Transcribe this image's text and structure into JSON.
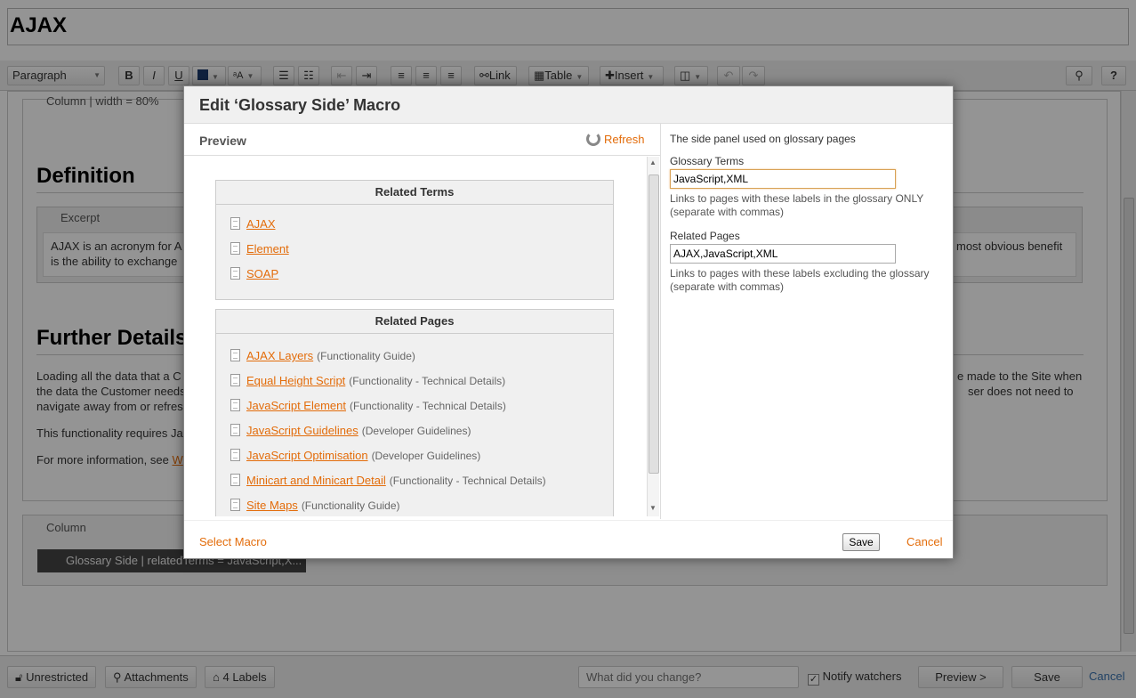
{
  "page": {
    "title": "AJAX"
  },
  "toolbar": {
    "paragraph": "Paragraph",
    "bold": "B",
    "italic": "I",
    "underline": "U",
    "link": "Link",
    "table": "Table",
    "insert": "Insert",
    "help": "?"
  },
  "editor": {
    "column1_label": "Column | width = 80%",
    "definition_heading": "Definition",
    "excerpt_label": "Excerpt",
    "excerpt_text_left": "AJAX is an acronym for A",
    "excerpt_text_left2": "is the ability to exchange",
    "excerpt_text_right": "most obvious benefit",
    "further_heading": "Further Details",
    "para1_left": "Loading all the data that a C",
    "para1_left2": "the data the Customer needs",
    "para1_left3": "navigate away from or refresh",
    "para1_right": "e made to the Site when",
    "para1_right2": "ser does not need to",
    "para2_left": "This functionality requires Jav",
    "para3_left": "For more information, see",
    "para3_link": "W",
    "column2_label": "Column",
    "glossary_macro": "Glossary Side | relatedTerms = JavaScript,X..."
  },
  "bottom": {
    "restrictions": "Unrestricted",
    "attachments": "Attachments",
    "labels": "4 Labels",
    "comment_placeholder": "What did you change?",
    "notify": "Notify watchers",
    "preview": "Preview >",
    "save": "Save",
    "cancel": "Cancel"
  },
  "dialog": {
    "title": "Edit ‘Glossary Side’ Macro",
    "preview_label": "Preview",
    "refresh": "Refresh",
    "related_terms_header": "Related Terms",
    "related_terms": [
      {
        "title": "AJAX"
      },
      {
        "title": "Element"
      },
      {
        "title": "SOAP"
      }
    ],
    "related_pages_header": "Related Pages",
    "related_pages": [
      {
        "title": "AJAX Layers",
        "category": "(Functionality Guide)"
      },
      {
        "title": "Equal Height Script",
        "category": "(Functionality - Technical Details)"
      },
      {
        "title": "JavaScript Element",
        "category": "(Functionality - Technical Details)"
      },
      {
        "title": "JavaScript Guidelines",
        "category": "(Developer Guidelines)"
      },
      {
        "title": "JavaScript Optimisation",
        "category": "(Developer Guidelines)"
      },
      {
        "title": "Minicart and Minicart Detail",
        "category": "(Functionality - Technical Details)"
      },
      {
        "title": "Site Maps",
        "category": "(Functionality Guide)"
      }
    ],
    "macro_description": "The side panel used on glossary pages",
    "glossary_terms_label": "Glossary Terms",
    "glossary_terms_value": "JavaScript,XML",
    "glossary_terms_help": "Links to pages with these labels in the glossary ONLY (separate with commas)",
    "related_pages_label": "Related Pages",
    "related_pages_value": "AJAX,JavaScript,XML",
    "related_pages_help": "Links to pages with these labels excluding the glossary (separate with commas)",
    "select_macro": "Select Macro",
    "save": "Save",
    "cancel": "Cancel"
  },
  "colors": {
    "accent": "#e36c0a"
  }
}
